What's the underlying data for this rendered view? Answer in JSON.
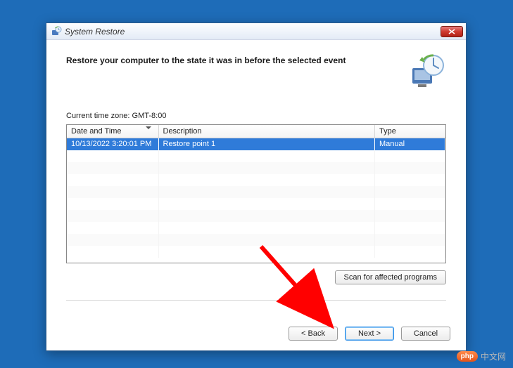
{
  "window": {
    "title": "System Restore"
  },
  "heading": "Restore your computer to the state it was in before the selected event",
  "timezone_label": "Current time zone: GMT-8:00",
  "table": {
    "columns": {
      "datetime": "Date and Time",
      "description": "Description",
      "type": "Type"
    },
    "rows": [
      {
        "datetime": "10/13/2022 3:20:01 PM",
        "description": "Restore point 1",
        "type": "Manual"
      }
    ]
  },
  "buttons": {
    "scan": "Scan for affected programs",
    "back": "< Back",
    "next": "Next >",
    "cancel": "Cancel"
  },
  "watermark": {
    "badge": "php",
    "text": "中文网"
  }
}
